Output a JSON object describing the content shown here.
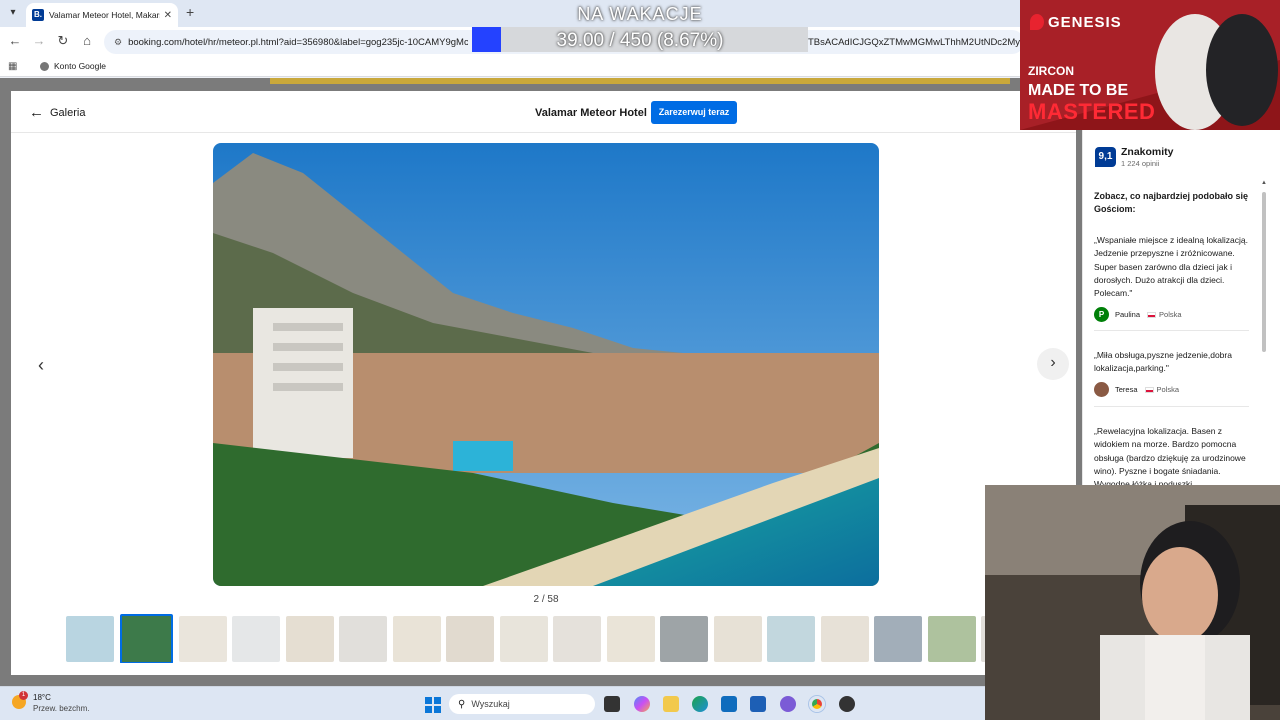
{
  "browser": {
    "tab_title": "Valamar Meteor Hotel, Makarsk",
    "tab_favicon": "B.",
    "url_left": "booking.com/hotel/hr/meteor.pl.html?aid=356980&label=gog235jc-10CAMY9gMc",
    "url_right": "TBsACAdICJGQxZTMwMGMwLThhM2UtNDc2My05",
    "bookmark": "Konto Google"
  },
  "stream_overlay": {
    "title": "NA WAKACJE",
    "progress_text": "39.00 / 450 (8.67%)"
  },
  "gallery": {
    "back_label": "Galeria",
    "hotel_name": "Valamar Meteor Hotel",
    "reserve_label": "Zarezerwuj teraz",
    "counter": "2 / 58",
    "current_index": 2,
    "total": 58
  },
  "thumbnails": [
    {
      "color": "#7fb3c9"
    },
    {
      "color": "#3d7a4a",
      "active": true
    },
    {
      "color": "#d9cfc0"
    },
    {
      "color": "#cfd3d6"
    },
    {
      "color": "#cfc3ad"
    },
    {
      "color": "#c9c4bd"
    },
    {
      "color": "#d7ccb6"
    },
    {
      "color": "#c8bca8"
    },
    {
      "color": "#d6cdbd"
    },
    {
      "color": "#cfc8bd"
    },
    {
      "color": "#d8cdb8"
    },
    {
      "color": "#4e5a5e"
    },
    {
      "color": "#d4c9b4"
    },
    {
      "color": "#8fb6c2"
    },
    {
      "color": "#d3c8b7"
    },
    {
      "color": "#556b80"
    },
    {
      "color": "#6b8f4f"
    },
    {
      "color": "#c9c3b9"
    }
  ],
  "reviews": {
    "score": "9,1",
    "rating_word": "Znakomity",
    "rating_count": "1 224 opinii",
    "heading": "Zobacz, co najbardziej podobało się Gościom:",
    "items": [
      {
        "text": "„Wspaniałe miejsce z idealną lokalizacją. Jedzenie przepyszne i zróżnicowane. Super basen zarówno dla dzieci jak i dorosłych. Dużo atrakcji dla dzieci. Polecam.\"",
        "name": "Paulina",
        "initial": "P",
        "avatar_color": "#008009",
        "country": "Polska"
      },
      {
        "text": "„Miła obsługa,pyszne jedzenie,dobra lokalizacja,parking.\"",
        "name": "Teresa",
        "initial": "",
        "avatar_color": "#8a5a44",
        "country": "Polska"
      },
      {
        "text": "„Rewelacyjna lokalizacja. Basen z widokiem na morze. Bardzo pomocna obsługa (bardzo dziękuję za urodzinowe wino). Pyszne i bogate śniadania. Wygodne łóżka i poduszki.",
        "name": "",
        "initial": "",
        "avatar_color": "",
        "country": ""
      }
    ]
  },
  "ad": {
    "brand": "GENESIS",
    "product": "ZIRCON",
    "tagline_1": "MADE TO BE",
    "tagline_2": "MASTERED"
  },
  "taskbar": {
    "temperature": "18°C",
    "condition": "Przew. bezchm.",
    "weather_badge": "1",
    "search_placeholder": "Wyszukaj"
  }
}
